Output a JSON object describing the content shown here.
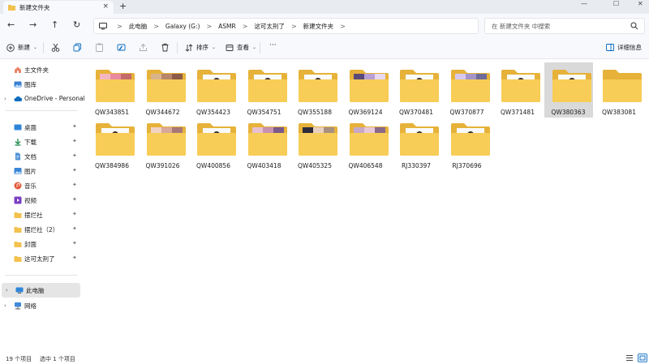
{
  "window": {
    "tab_title": "新建文件夹",
    "tab_close": "×",
    "new_tab": "+",
    "controls": {
      "minimize": "—",
      "maximize": "☐",
      "close": "✕"
    }
  },
  "nav": {
    "back": "←",
    "forward": "→",
    "up": "↑",
    "refresh": "↻",
    "breadcrumb": [
      "此电脑",
      "Galaxy (G:)",
      "ASMR",
      "这可太刑了",
      "新建文件夹"
    ],
    "sep": ">",
    "search_placeholder": "在 新建文件夹 中搜索"
  },
  "toolbar": {
    "new_label": "新建",
    "sort_label": "排序",
    "view_label": "查看",
    "more_label": "···",
    "details_label": "详细信息"
  },
  "sidebar": {
    "items": [
      {
        "label": "主文件夹",
        "icon": "home-icon",
        "pinned": false
      },
      {
        "label": "图库",
        "icon": "gallery-icon",
        "pinned": false
      },
      {
        "label": "OneDrive - Personal",
        "icon": "cloud-icon",
        "pinned": false
      },
      {
        "label": "桌面",
        "icon": "desktop-icon",
        "pinned": true
      },
      {
        "label": "下载",
        "icon": "download-icon",
        "pinned": true
      },
      {
        "label": "文档",
        "icon": "document-icon",
        "pinned": true
      },
      {
        "label": "图片",
        "icon": "picture-icon",
        "pinned": true
      },
      {
        "label": "音乐",
        "icon": "music-icon",
        "pinned": true
      },
      {
        "label": "视频",
        "icon": "video-icon",
        "pinned": true
      },
      {
        "label": "摆烂社",
        "icon": "folder-icon",
        "pinned": true
      },
      {
        "label": "摆烂社（2）",
        "icon": "folder-icon",
        "pinned": true
      },
      {
        "label": "封面",
        "icon": "folder-icon",
        "pinned": true
      },
      {
        "label": "这可太刑了",
        "icon": "folder-icon",
        "pinned": true
      },
      {
        "label": "此电脑",
        "icon": "pc-icon",
        "pinned": false
      },
      {
        "label": "网络",
        "icon": "network-icon",
        "pinned": false
      }
    ],
    "pin_glyph": "📌",
    "chevron": "›"
  },
  "folders": [
    {
      "name": "QW343851",
      "thumb": "pink"
    },
    {
      "name": "QW344672",
      "thumb": "tan"
    },
    {
      "name": "QW354423",
      "thumb": "doc"
    },
    {
      "name": "QW354751",
      "thumb": "doc"
    },
    {
      "name": "QW355188",
      "thumb": "doc"
    },
    {
      "name": "QW369124",
      "thumb": "purple"
    },
    {
      "name": "QW370481",
      "thumb": "doc"
    },
    {
      "name": "QW370877",
      "thumb": "lilac"
    },
    {
      "name": "QW371481",
      "thumb": "doc"
    },
    {
      "name": "QW380363",
      "thumb": "doc",
      "selected": true
    },
    {
      "name": "QW383081",
      "thumb": "none"
    },
    {
      "name": "QW384986",
      "thumb": "doc"
    },
    {
      "name": "QW391026",
      "thumb": "skin"
    },
    {
      "name": "QW400856",
      "thumb": "doc"
    },
    {
      "name": "QW403418",
      "thumb": "rose"
    },
    {
      "name": "QW405325",
      "thumb": "dark"
    },
    {
      "name": "QW406548",
      "thumb": "mauve"
    },
    {
      "name": "RJ330397",
      "thumb": "doc"
    },
    {
      "name": "RJ370696",
      "thumb": "doc"
    }
  ],
  "status": {
    "count": "19 个项目",
    "selected": "选中 1 个项目"
  },
  "colors": {
    "folder_back": "#e6b23a",
    "folder_front": "#f7cd57",
    "selection": "#d9d9d9",
    "accent": "#0067c0"
  }
}
